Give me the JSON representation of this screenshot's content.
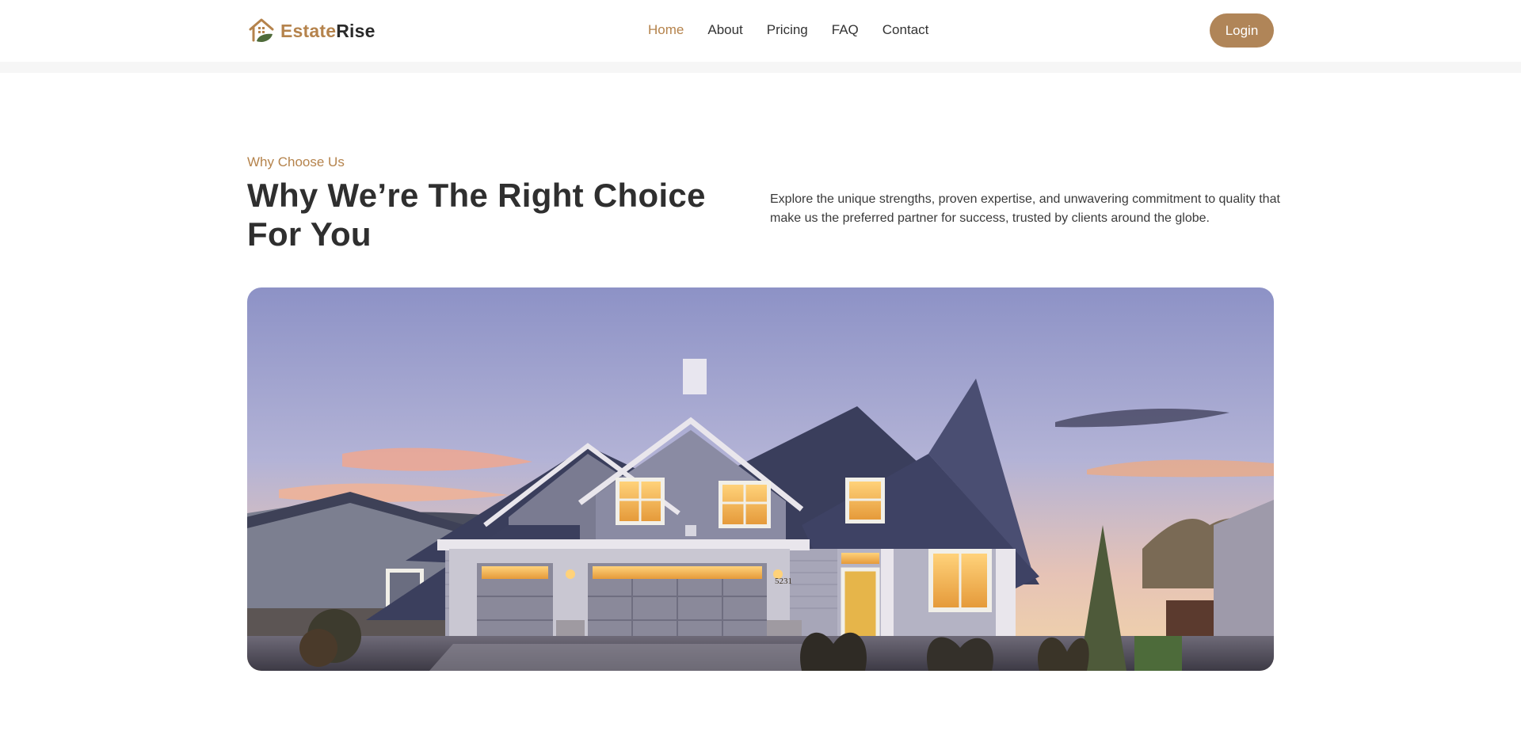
{
  "brand": {
    "part1": "Estate",
    "part2": "Rise"
  },
  "nav": [
    {
      "label": "Home",
      "active": true
    },
    {
      "label": "About",
      "active": false
    },
    {
      "label": "Pricing",
      "active": false
    },
    {
      "label": "FAQ",
      "active": false
    },
    {
      "label": "Contact",
      "active": false
    }
  ],
  "login_label": "Login",
  "section": {
    "eyebrow": "Why Choose Us",
    "title": "Why We’re The Right Choice For You",
    "description": "Explore the unique strengths, proven expertise, and unwavering commitment to quality that make us the preferred partner for success, trusted by clients around the globe."
  },
  "hero": {
    "house_number": "5231"
  },
  "colors": {
    "accent": "#b5834c",
    "button": "#b08558",
    "text": "#2f2f2f"
  },
  "icons": {
    "logo": "house-leaf-icon"
  }
}
